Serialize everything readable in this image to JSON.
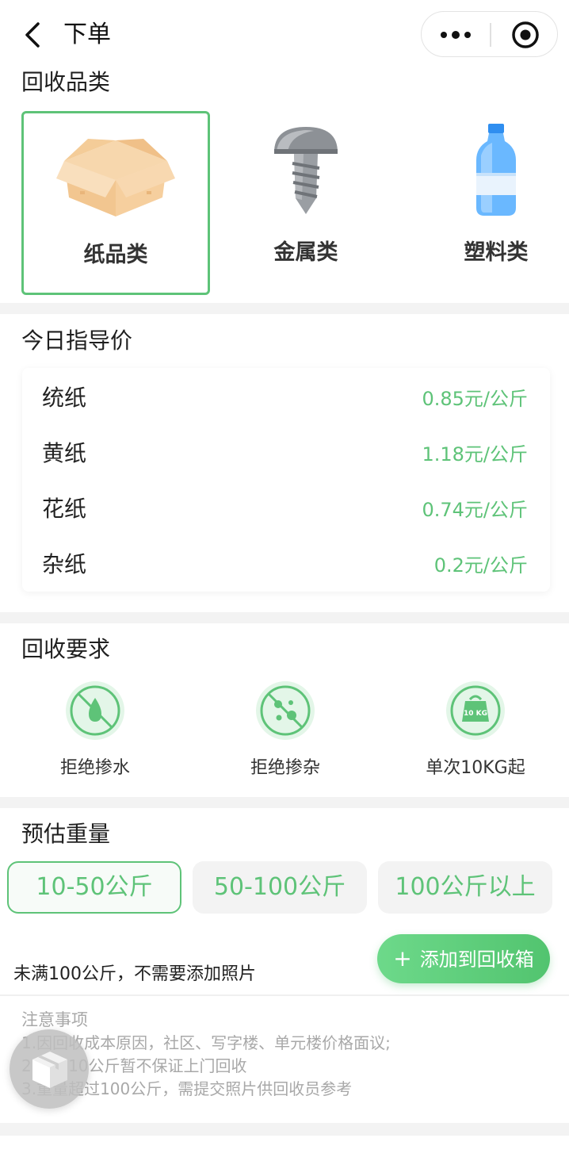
{
  "header": {
    "title": "下单"
  },
  "category_section": {
    "title": "回收品类",
    "items": [
      {
        "label": "纸品类",
        "icon": "cardboard-box-icon",
        "selected": true
      },
      {
        "label": "金属类",
        "icon": "screw-icon",
        "selected": false
      },
      {
        "label": "塑料类",
        "icon": "plastic-bottle-icon",
        "selected": false
      }
    ]
  },
  "price_section": {
    "title": "今日指导价",
    "rows": [
      {
        "name": "统纸",
        "price": "0.85元/公斤"
      },
      {
        "name": "黄纸",
        "price": "1.18元/公斤"
      },
      {
        "name": "花纸",
        "price": "0.74元/公斤"
      },
      {
        "name": "杂纸",
        "price": "0.2元/公斤"
      }
    ]
  },
  "requirements": {
    "title": "回收要求",
    "items": [
      {
        "label": "拒绝掺水",
        "icon": "no-water-icon"
      },
      {
        "label": "拒绝掺杂",
        "icon": "no-impurities-icon"
      },
      {
        "label": "单次10KG起",
        "icon": "weight-10kg-icon",
        "icon_text": "10 KG"
      }
    ]
  },
  "weight": {
    "title": "预估重量",
    "options": [
      {
        "label": "10-50公斤",
        "selected": true
      },
      {
        "label": "50-100公斤",
        "selected": false
      },
      {
        "label": "100公斤以上",
        "selected": false
      }
    ],
    "hint": "未满100公斤，不需要添加照片",
    "add_button": {
      "plus": "+",
      "label": "添加到回收箱"
    }
  },
  "notes": {
    "title": "注意事项",
    "lines": [
      "1.因回收成本原因，社区、写字楼、单元楼价格面议;",
      "2.低于10公斤暂不保证上门回收",
      "3.重量超过100公斤，需提交照片供回收员参考"
    ]
  },
  "colors": {
    "accent": "#5ec378",
    "band": "#f3f3f3",
    "note_text": "#a8a8a8"
  }
}
